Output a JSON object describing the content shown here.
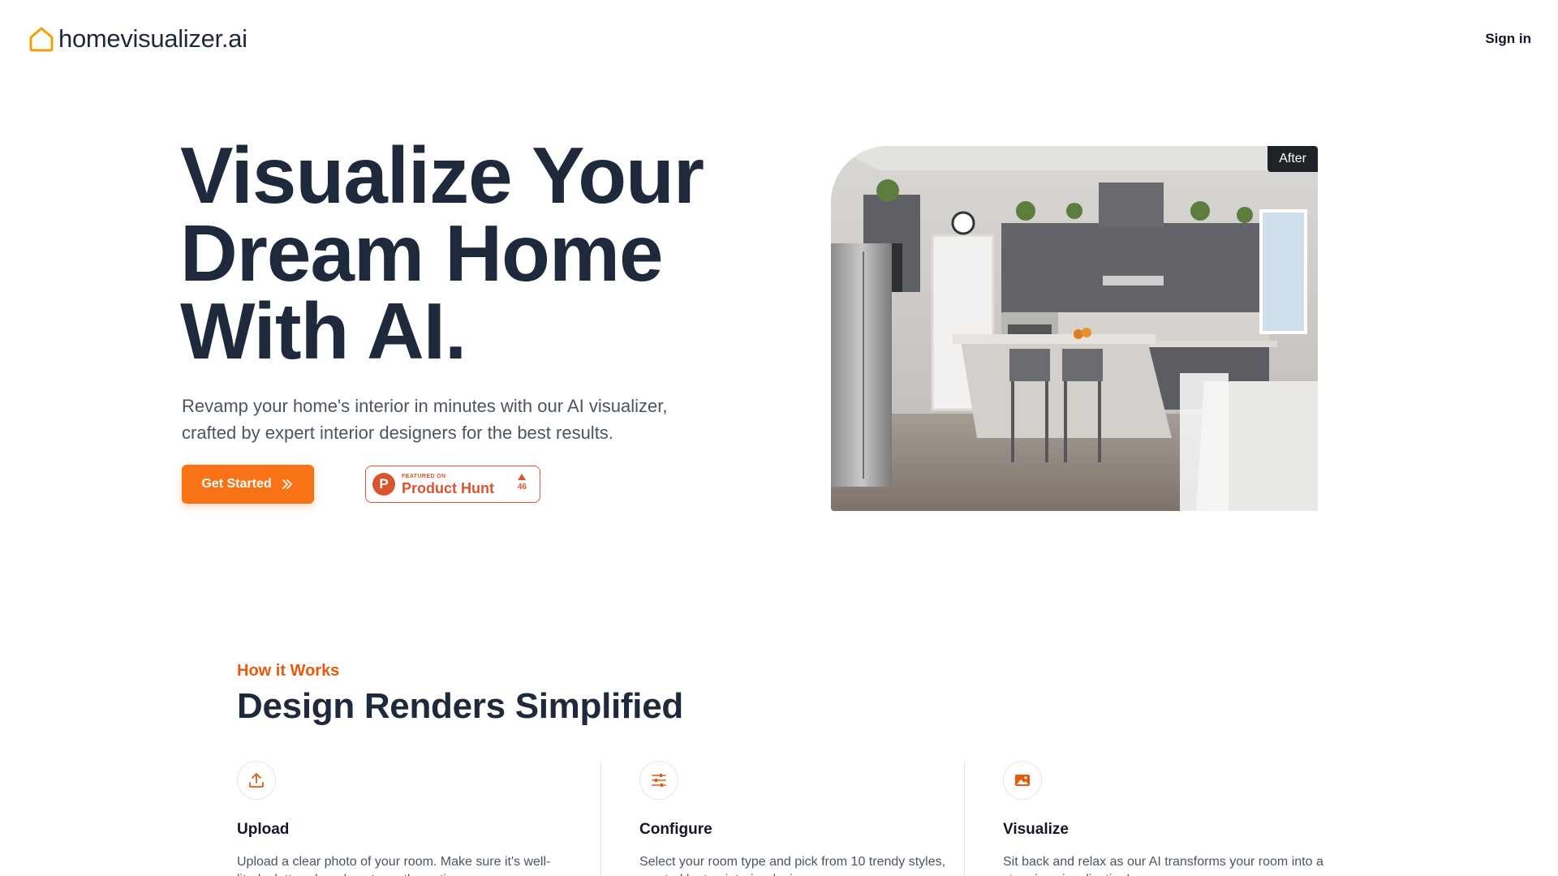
{
  "brand": {
    "name": "homevisualizer.ai",
    "accent": "#f97316"
  },
  "nav": {
    "signin_label": "Sign in"
  },
  "hero": {
    "title_lines": [
      "Visualize Your",
      "Dream Home",
      "With AI."
    ],
    "subtitle": "Revamp your home's interior in minutes with our AI visualizer, crafted by expert interior designers for the best results.",
    "cta_label": "Get Started",
    "product_hunt": {
      "featured": "FEATURED ON",
      "name": "Product Hunt",
      "votes": "46"
    },
    "image_tag": "After"
  },
  "how": {
    "kicker": "How it Works",
    "title": "Design Renders Simplified",
    "steps": [
      {
        "icon": "upload-icon",
        "title": "Upload",
        "desc": "Upload a clear photo of your room. Make sure it's well-lit, decluttered, and captures the entire space."
      },
      {
        "icon": "sliders-icon",
        "title": "Configure",
        "desc": "Select your room type and pick from 10 trendy styles, curated by top interior designers."
      },
      {
        "icon": "image-icon",
        "title": "Visualize",
        "desc": "Sit back and relax as our AI transforms your room into a stunning visualization!"
      }
    ]
  }
}
